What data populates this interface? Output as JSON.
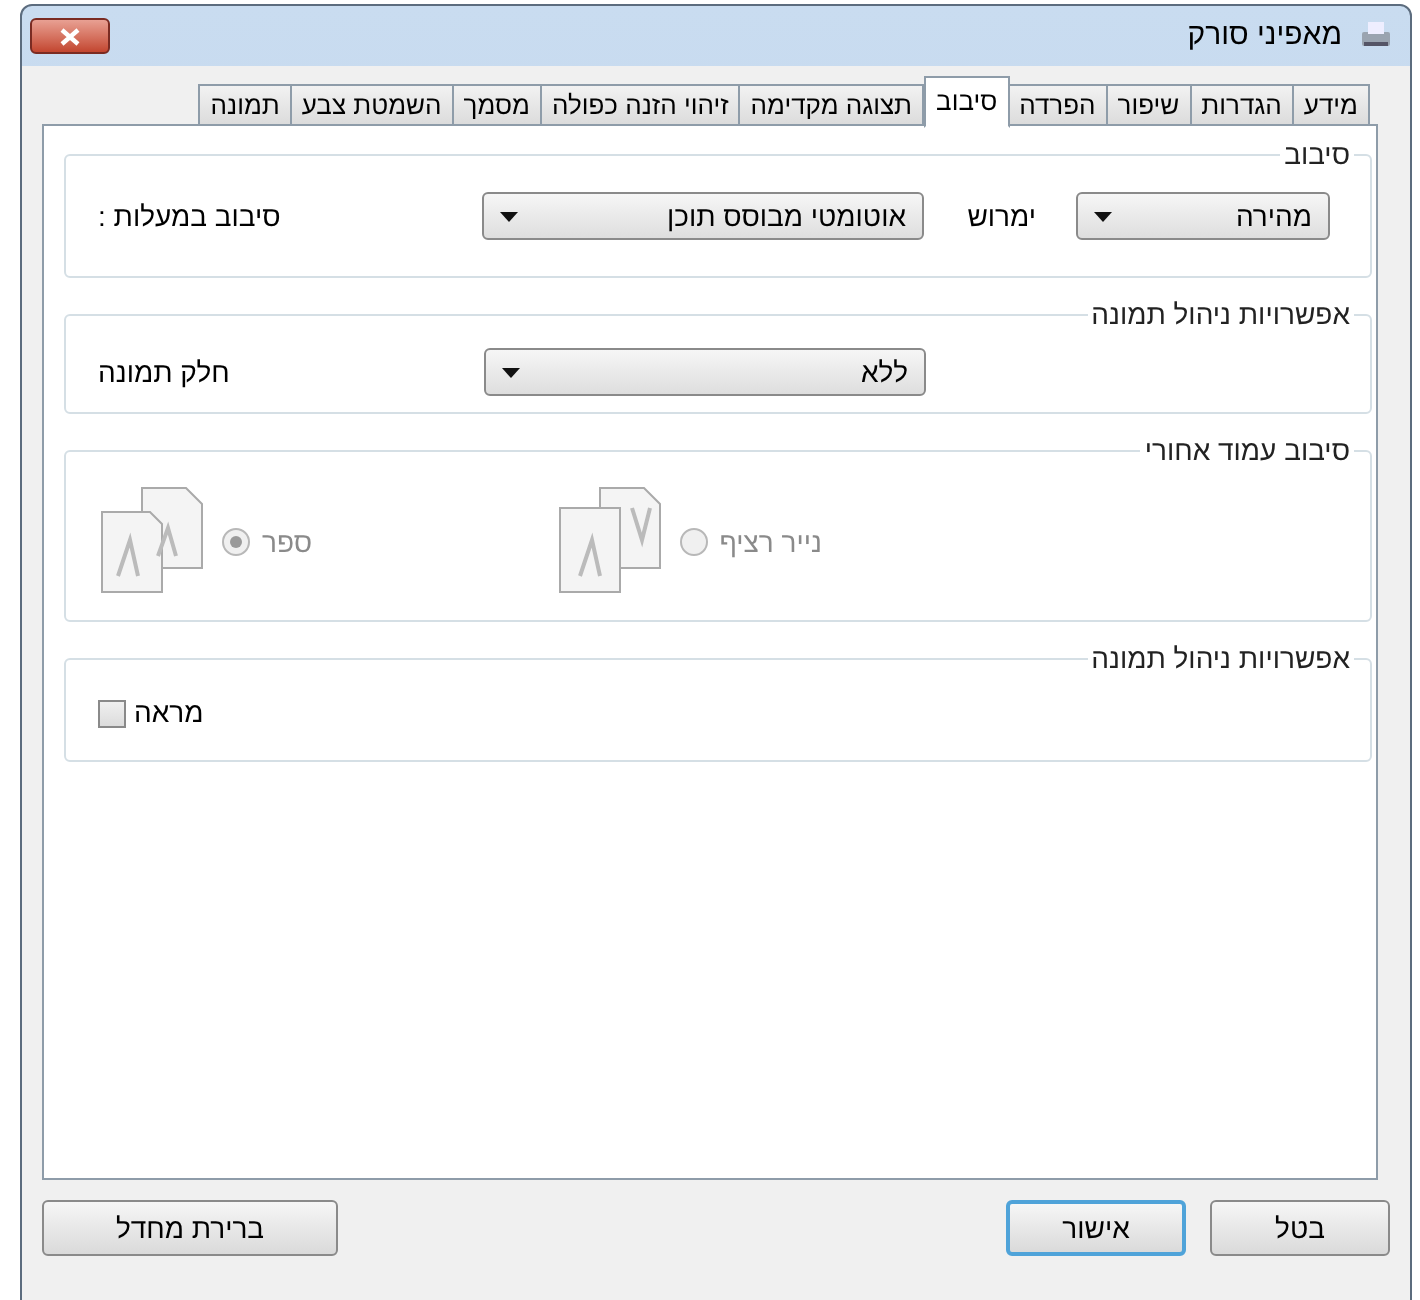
{
  "window": {
    "title": "מאפיני סורק"
  },
  "tabs": [
    {
      "label": "מידע",
      "selected": false
    },
    {
      "label": "הגדרות",
      "selected": false
    },
    {
      "label": "שיפור",
      "selected": false
    },
    {
      "label": "הפרדה",
      "selected": false
    },
    {
      "label": "סיבוב",
      "selected": true
    },
    {
      "label": "תצוגה מקדימה",
      "selected": false
    },
    {
      "label": "זיהוי הזנה כפולה",
      "selected": false
    },
    {
      "label": "מסמך",
      "selected": false
    },
    {
      "label": "השמטת צבע",
      "selected": false
    },
    {
      "label": "תמונה",
      "selected": false
    }
  ],
  "rotation": {
    "title": "סיבוב",
    "mode_select": {
      "value": "מהירה"
    },
    "mode_label": "ימרוש",
    "angle_select": {
      "value": "אוטומטי מבוסס תוכן"
    },
    "angle_label": "סיבוב במעלות :"
  },
  "image_options": {
    "title": "אפשרויות ניהול תמונה",
    "split_label": "חלק תמונה",
    "split_select": {
      "value": "ללא"
    }
  },
  "back_rotation": {
    "title": "סיבוב עמוד אחורי",
    "options": [
      {
        "label": "נייר רציף",
        "kind": "fanfold",
        "selected": false,
        "disabled": true
      },
      {
        "label": "ספר",
        "kind": "book",
        "selected": true,
        "disabled": true
      }
    ]
  },
  "image_options_2": {
    "title": "אפשרויות ניהול תמונה",
    "mirror": {
      "label": "מראה",
      "checked": false
    }
  },
  "buttons": [
    {
      "label": "בטל",
      "default": false
    },
    {
      "label": "אישור",
      "default": true
    },
    {
      "label": "ברירת מחדל",
      "default": false
    }
  ]
}
